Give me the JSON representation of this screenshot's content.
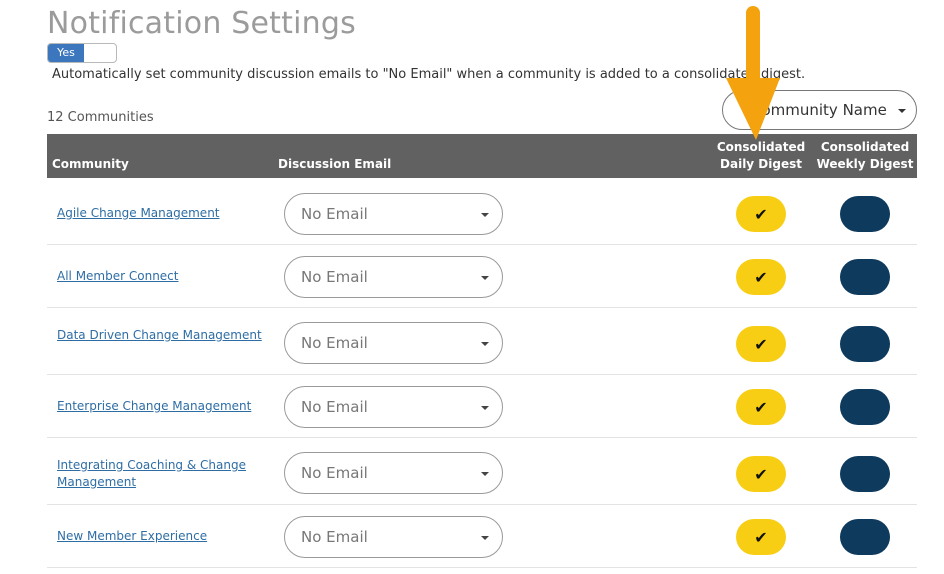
{
  "page": {
    "title": "Notification Settings",
    "toggle": {
      "label": "Yes",
      "state": "on"
    },
    "toggle_description": "Automatically set community discussion emails to \"No Email\" when a community is added to a consolidated digest.",
    "community_count": "12 Communities",
    "sort_select": {
      "value": "Community Name"
    }
  },
  "table": {
    "headers": {
      "community": "Community",
      "discussion_email": "Discussion Email",
      "daily_line1": "Consolidated",
      "daily_line2": "Daily Digest",
      "weekly_line1": "Consolidated",
      "weekly_line2": "Weekly Digest"
    },
    "rows": [
      {
        "name": "Agile Change Management",
        "email": "No Email",
        "daily": true,
        "weekly": false
      },
      {
        "name": "All Member Connect",
        "email": "No Email",
        "daily": true,
        "weekly": false
      },
      {
        "name": "Data Driven Change Management",
        "email": "No Email",
        "daily": true,
        "weekly": false
      },
      {
        "name": "Enterprise Change Management",
        "email": "No Email",
        "daily": true,
        "weekly": false
      },
      {
        "name": "Integrating Coaching & Change Management",
        "email": "No Email",
        "daily": true,
        "weekly": false
      },
      {
        "name": "New Member Experience",
        "email": "No Email",
        "daily": true,
        "weekly": false
      }
    ]
  },
  "colors": {
    "daily_on": "#f7ce14",
    "weekly_off": "#0e3a5e",
    "header_bg": "#616161",
    "link": "#2e6da4",
    "annotation_arrow": "#f4a20e"
  },
  "icons": {
    "check": "checkmark-icon",
    "caret": "chevron-down-icon",
    "annotation": "arrow-down-icon"
  }
}
